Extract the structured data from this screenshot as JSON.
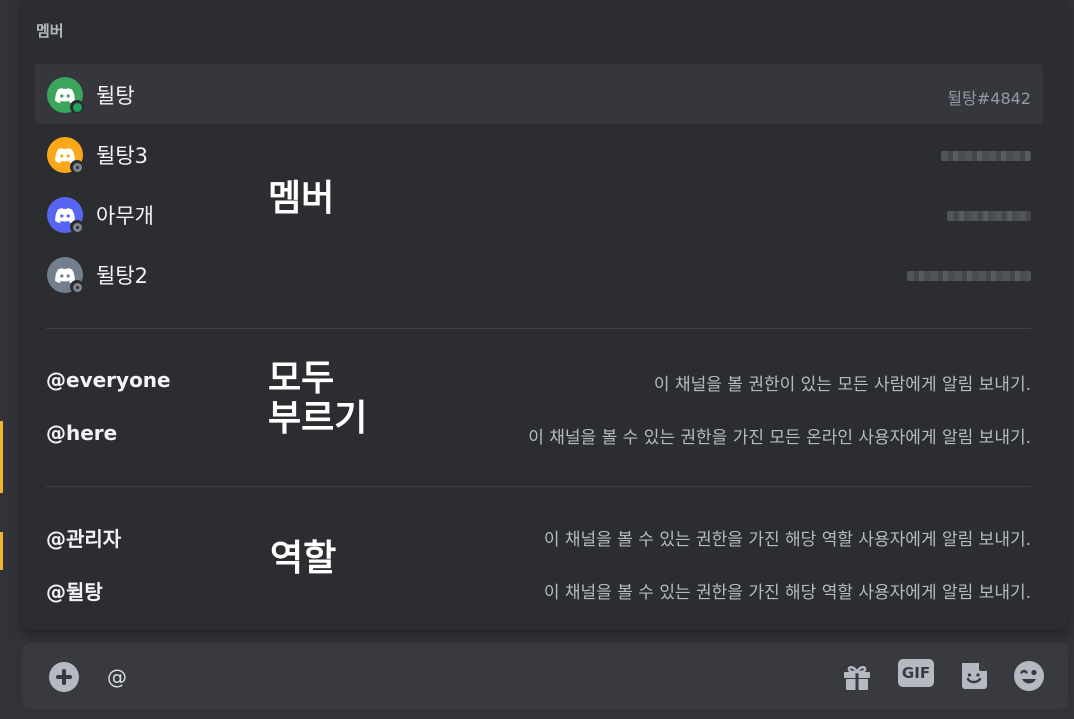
{
  "popout": {
    "header": "멤버",
    "members": [
      {
        "name": "뒬탕",
        "tag": "뒬탕#4842",
        "avatar_color": "#3ba55d",
        "status": "online",
        "selected": true
      },
      {
        "name": "뒬탕3",
        "avatar_color": "#faa81a",
        "status": "offline",
        "selected": false
      },
      {
        "name": "아무개",
        "avatar_color": "#5865f2",
        "status": "offline",
        "selected": false
      },
      {
        "name": "뒬탕2",
        "avatar_color": "#747f8d",
        "status": "offline",
        "selected": false
      }
    ],
    "commands": [
      {
        "name": "@everyone",
        "desc": "이 채널을 볼 권한이 있는 모든 사람에게 알림 보내기."
      },
      {
        "name": "@here",
        "desc": "이 채널을 볼 수 있는 권한을 가진 모든 온라인 사용자에게 알림 보내기."
      }
    ],
    "roles": [
      {
        "name": "@관리자",
        "desc": "이 채널을 볼 수 있는 권한을 가진 해당 역할 사용자에게 알림 보내기."
      },
      {
        "name": "@뒬탕",
        "desc": "이 채널을 볼 수 있는 권한을 가진 해당 역할 사용자에게 알림 보내기."
      }
    ]
  },
  "annotations": {
    "members": "멤버",
    "mention_all_line1": "모두",
    "mention_all_line2": "부르기",
    "roles": "역할"
  },
  "input": {
    "value": "@",
    "gif_label": "GIF"
  },
  "icons": {
    "add": "plus-circle-icon",
    "gift": "gift-icon",
    "gif": "gif-icon",
    "sticker": "sticker-icon",
    "emoji": "emoji-icon"
  },
  "colors": {
    "mention_highlight": "#f0b232",
    "online": "#23a559"
  }
}
